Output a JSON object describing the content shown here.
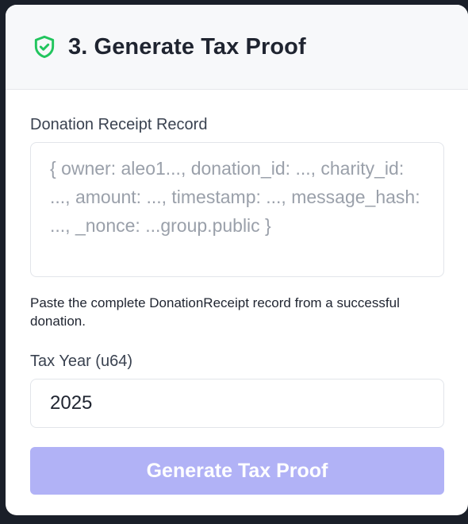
{
  "card": {
    "title": "3. Generate Tax Proof",
    "icon": "shield-check-icon",
    "icon_color": "#22c55e"
  },
  "receipt": {
    "label": "Donation Receipt Record",
    "value": "",
    "placeholder": "{ owner: aleo1..., donation_id: ..., charity_id: ..., amount: ..., timestamp: ..., message_hash: ..., _nonce: ...group.public }",
    "help": "Paste the complete DonationReceipt record from a successful donation."
  },
  "tax_year": {
    "label": "Tax Year (u64)",
    "value": "2025"
  },
  "submit": {
    "label": "Generate Tax Proof",
    "color": "#b1b2f6"
  }
}
